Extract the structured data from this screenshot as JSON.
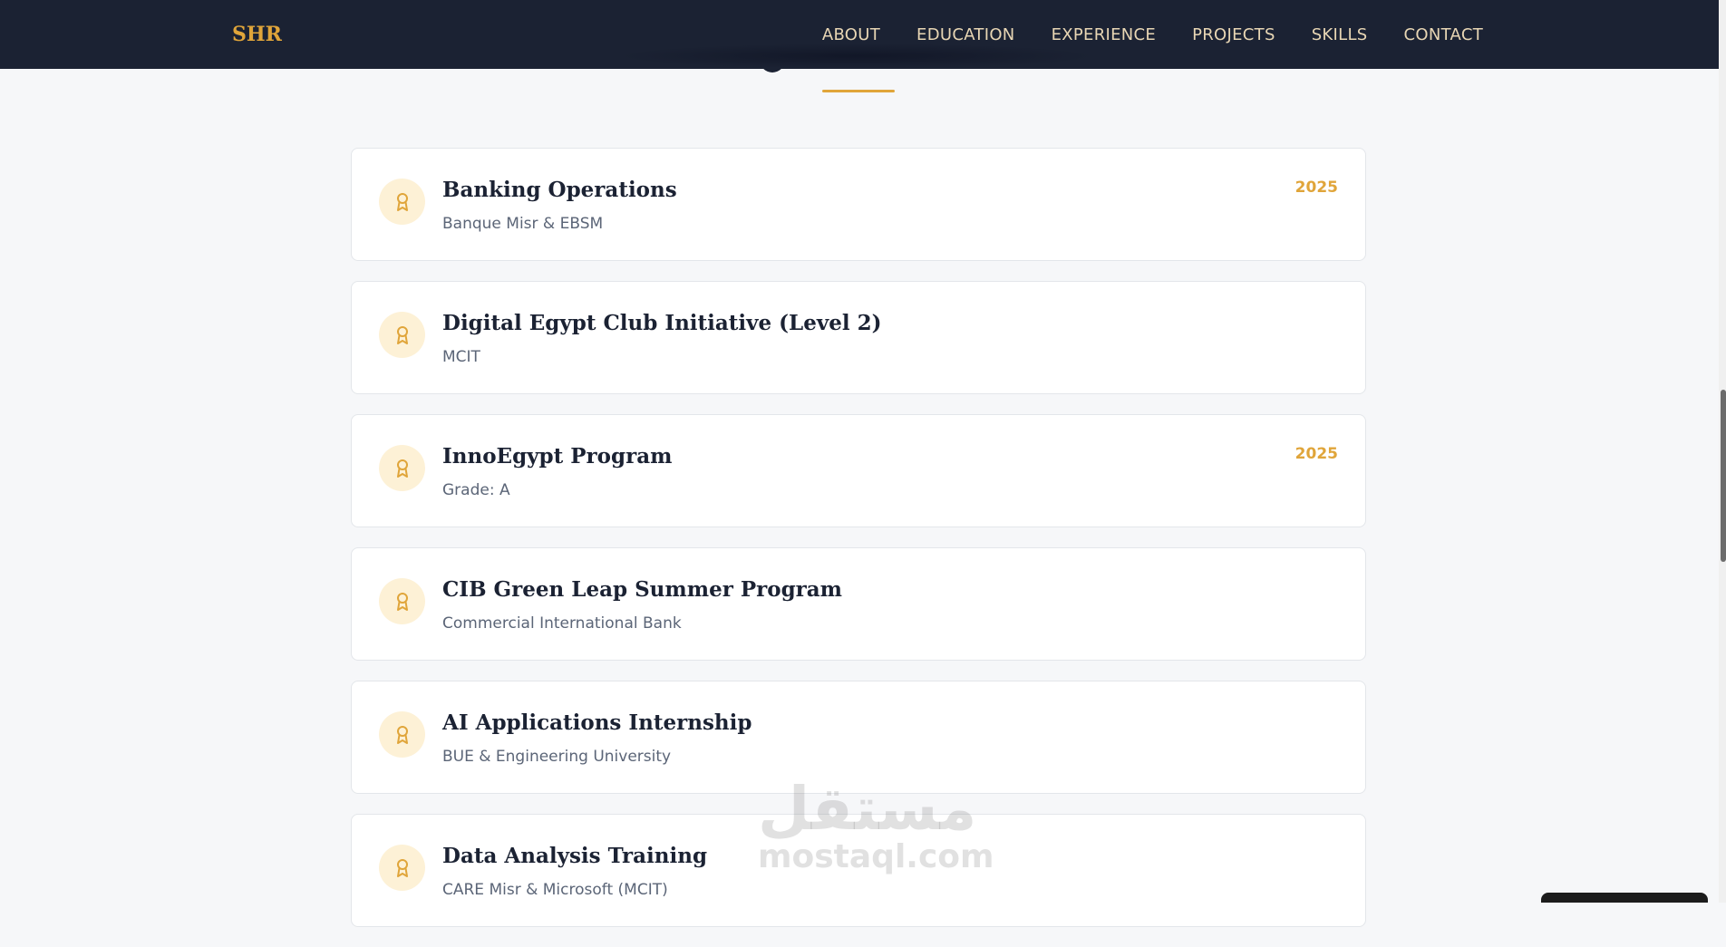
{
  "nav": {
    "logo": "SHR",
    "links": [
      "ABOUT",
      "EDUCATION",
      "EXPERIENCE",
      "PROJECTS",
      "SKILLS",
      "CONTACT"
    ]
  },
  "theme": {
    "nav_bg": "#1b2233",
    "accent": "#e0a53a",
    "badge_bg": "#fdf1d6",
    "page_bg": "#f6f7f9"
  },
  "certificates": [
    {
      "title": "Banking Operations",
      "issuer": "Banque Misr & EBSM",
      "year": "2025",
      "icon": "award-icon"
    },
    {
      "title": "Digital Egypt Club Initiative (Level 2)",
      "issuer": "MCIT",
      "year": "",
      "icon": "award-icon"
    },
    {
      "title": "InnoEgypt Program",
      "issuer": "Grade: A",
      "year": "2025",
      "icon": "award-icon"
    },
    {
      "title": "CIB Green Leap Summer Program",
      "issuer": "Commercial International Bank",
      "year": "",
      "icon": "award-icon"
    },
    {
      "title": "AI Applications Internship",
      "issuer": "BUE & Engineering University",
      "year": "",
      "icon": "award-icon"
    },
    {
      "title": "Data Analysis Training",
      "issuer": "CARE Misr & Microsoft (MCIT)",
      "year": "",
      "icon": "award-icon"
    }
  ],
  "watermark": {
    "arabic": "مستقل",
    "latin": "mostaql.com"
  }
}
